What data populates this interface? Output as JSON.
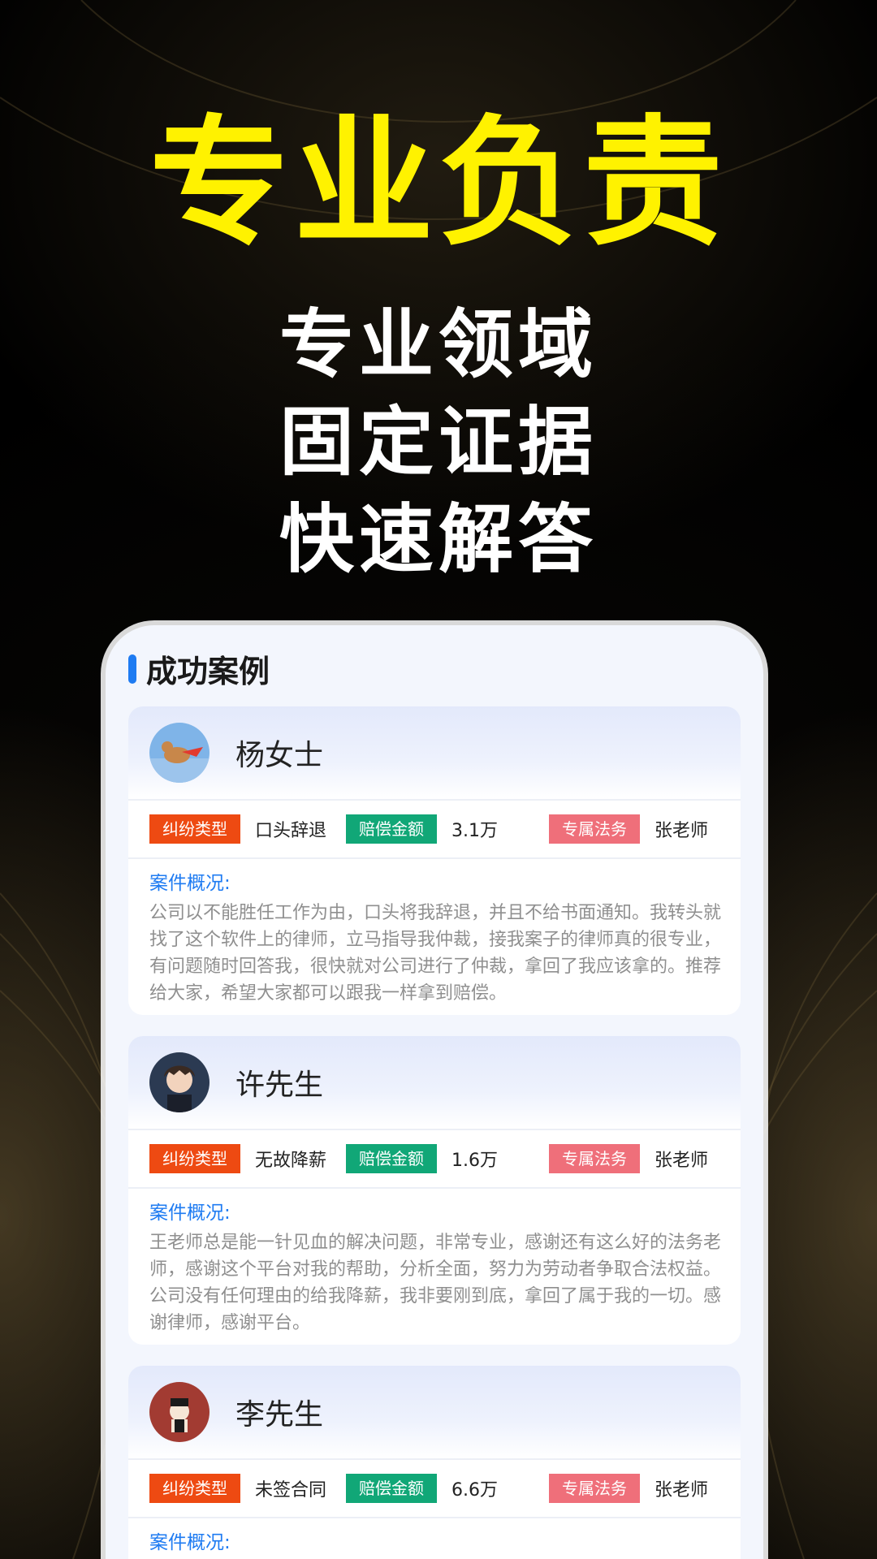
{
  "hero": {
    "title": "专业负责",
    "lines": [
      "专业领域",
      "固定证据",
      "快速解答"
    ]
  },
  "section": {
    "title": "成功案例"
  },
  "labels": {
    "dispute_type": "纠纷类型",
    "compensation": "赔偿金额",
    "legal_service": "专属法务",
    "overview": "案件概况:"
  },
  "cases": [
    {
      "name": "杨女士",
      "dispute_type": "口头辞退",
      "amount": "3.1万",
      "lawyer": "张老师",
      "overview": "公司以不能胜任工作为由，口头将我辞退，并且不给书面通知。我转头就找了这个软件上的律师，立马指导我仲裁，接我案子的律师真的很专业，有问题随时回答我，很快就对公司进行了仲裁，拿回了我应该拿的。推荐给大家，希望大家都可以跟我一样拿到赔偿。"
    },
    {
      "name": "许先生",
      "dispute_type": "无故降薪",
      "amount": "1.6万",
      "lawyer": "张老师",
      "overview": "王老师总是能一针见血的解决问题，非常专业，感谢还有这么好的法务老师，感谢这个平台对我的帮助，分析全面，努力为劳动者争取合法权益。公司没有任何理由的给我降薪，我非要刚到底，拿回了属于我的一切。感谢律师，感谢平台。"
    },
    {
      "name": "李先生",
      "dispute_type": "未签合同",
      "amount": "6.6万",
      "lawyer": "张老师",
      "overview": ""
    }
  ],
  "colors": {
    "title_yellow": "#fff200",
    "accent_blue": "#1e7bf2",
    "tag_red": "#ee4a12",
    "tag_green": "#11a777",
    "tag_pink": "#ef6f7a"
  },
  "icons": {
    "avatar_1": "dog-flying-avatar",
    "avatar_2": "anime-boy-avatar",
    "avatar_3": "cartoon-figure-avatar"
  }
}
